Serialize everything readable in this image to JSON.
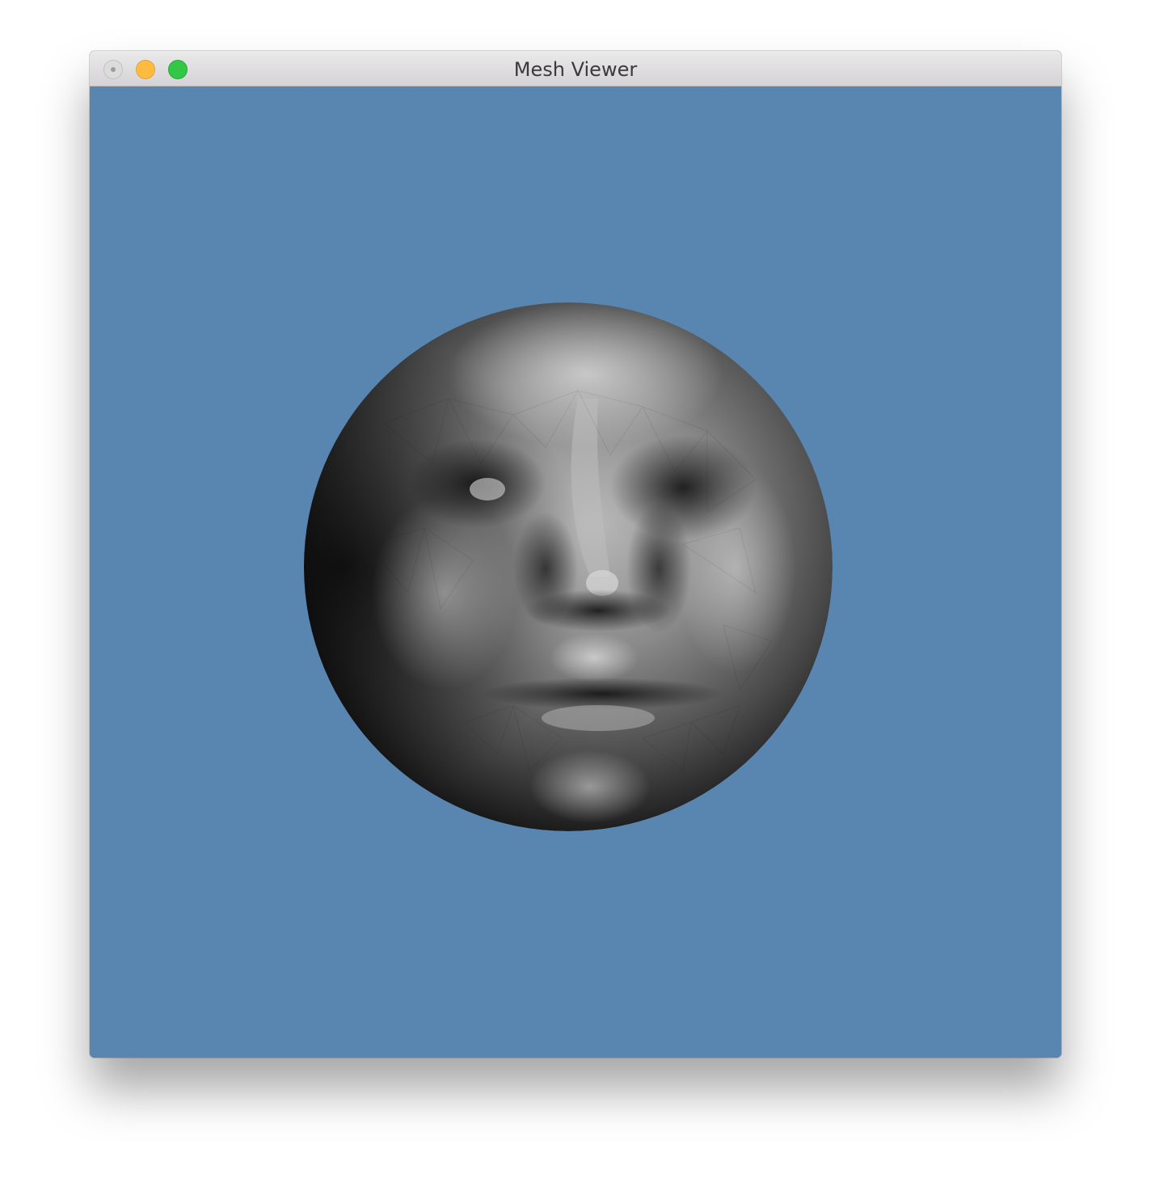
{
  "window": {
    "title": "Mesh Viewer"
  },
  "viewport": {
    "background_color": "#5985b1",
    "content": "3d-face-mesh-render"
  },
  "colors": {
    "close": "#dcdcdc",
    "minimize": "#fdbc40",
    "maximize": "#33c748"
  }
}
